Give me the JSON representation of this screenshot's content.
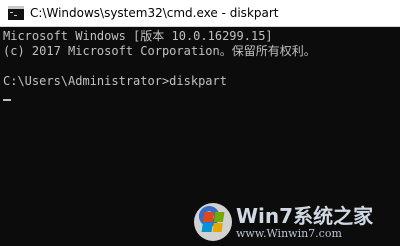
{
  "window": {
    "title": "C:\\Windows\\system32\\cmd.exe - diskpart"
  },
  "console": {
    "lines": [
      "Microsoft Windows [版本 10.0.16299.15]",
      "(c) 2017 Microsoft Corporation。保留所有权利。",
      "",
      "C:\\Users\\Administrator>diskpart"
    ]
  },
  "watermark": {
    "brand": "Win7系统之家",
    "url": "www.Winwin7.com"
  }
}
